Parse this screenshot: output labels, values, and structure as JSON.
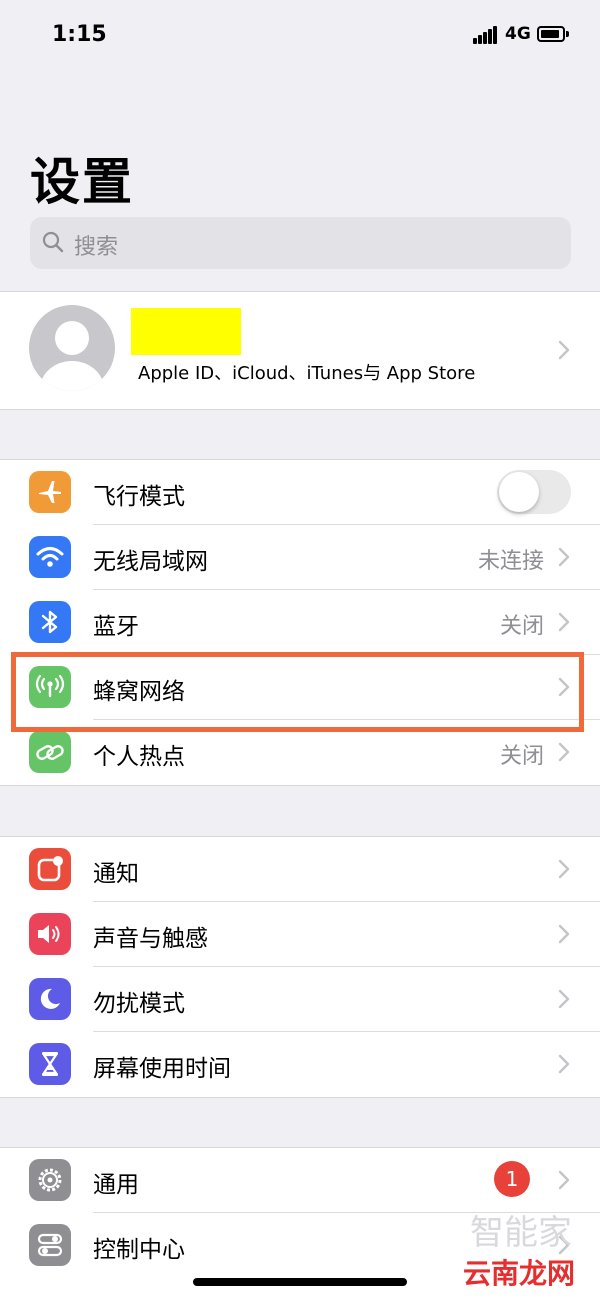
{
  "status_bar": {
    "time": "1:15",
    "network": "4G"
  },
  "page_title": "设置",
  "search": {
    "placeholder": "搜索"
  },
  "profile": {
    "subtitle": "Apple ID、iCloud、iTunes与 App Store"
  },
  "connectivity": [
    {
      "label": "飞行模式",
      "icon": "airplane-icon",
      "color": "#f19a38",
      "toggle": false
    },
    {
      "label": "无线局域网",
      "icon": "wifi-icon",
      "color": "#3478f6",
      "value": "未连接"
    },
    {
      "label": "蓝牙",
      "icon": "bluetooth-icon",
      "color": "#3478f6",
      "value": "关闭"
    },
    {
      "label": "蜂窝网络",
      "icon": "cellular-icon",
      "color": "#65c466",
      "value": ""
    },
    {
      "label": "个人热点",
      "icon": "hotspot-icon",
      "color": "#65c466",
      "value": "关闭"
    }
  ],
  "notifications_group": [
    {
      "label": "通知",
      "icon": "notifications-icon",
      "color": "#eb4d3d"
    },
    {
      "label": "声音与触感",
      "icon": "sound-icon",
      "color": "#eb445a"
    },
    {
      "label": "勿扰模式",
      "icon": "moon-icon",
      "color": "#5e5ce6"
    },
    {
      "label": "屏幕使用时间",
      "icon": "hourglass-icon",
      "color": "#5e5ce6"
    }
  ],
  "general_group": [
    {
      "label": "通用",
      "icon": "gear-icon",
      "color": "#8e8e93",
      "badge": "1"
    },
    {
      "label": "控制中心",
      "icon": "control-center-icon",
      "color": "#8e8e93"
    }
  ],
  "watermark": {
    "text": "云南龙网",
    "faint": "智能家"
  }
}
